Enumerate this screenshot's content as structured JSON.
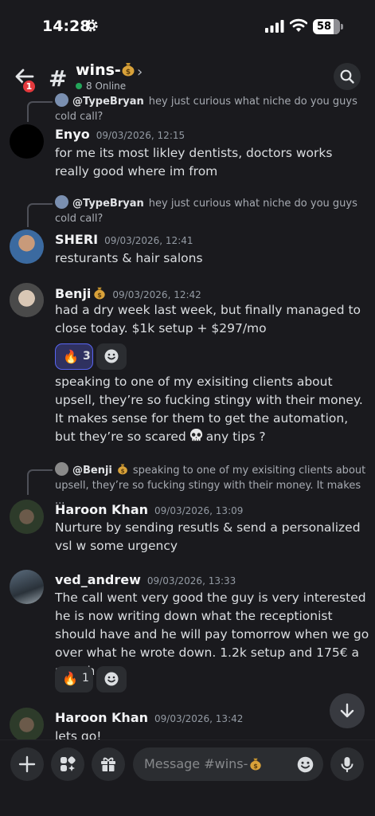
{
  "status_bar": {
    "time": "14:28",
    "battery": "58"
  },
  "header": {
    "back_badge": "1",
    "channel_name": "wins-",
    "online_text": "8 Online"
  },
  "messages": [
    {
      "reply_to": {
        "author": "@TypeBryan",
        "text": "hey just curious what niche do you guys cold call?"
      },
      "author": "Enyo",
      "timestamp": "09/03/2026, 12:15",
      "text": "for me its most likley dentists, doctors works really good where im from"
    },
    {
      "reply_to": {
        "author": "@TypeBryan",
        "text": "hey just curious what niche do you guys cold call?"
      },
      "author": "SHERI",
      "timestamp": "09/03/2026, 12:41",
      "text": "resturants & hair salons"
    },
    {
      "author": "Benji",
      "timestamp": "09/03/2026, 12:42",
      "text": "had a dry week last week, but finally managed to close today. $1k setup + $297/mo",
      "reaction": {
        "emoji": "🔥",
        "count": "3"
      },
      "text2": "speaking to one of my exisiting clients about upsell, they’re so fucking stingy with their money. It makes sense for them to get the automation, but they’re so scared",
      "text2_end": "any tips ?"
    },
    {
      "reply_to": {
        "author": "@Benji",
        "text": "speaking to one of my exisiting clients about upsell, they’re so fucking stingy with their money. It makes ..."
      },
      "author": "Haroon Khan",
      "timestamp": "09/03/2026, 13:09",
      "text": "Nurture by sending resutls & send a personalized vsl w some urgency"
    },
    {
      "author": "ved_andrew",
      "timestamp": "09/03/2026, 13:33",
      "text": "The call went very good the guy is very interested he is now writing down what the receptionist should have and he will pay tomorrow when we go over what he wrote down. 1.2k setup and 175€ a month",
      "reaction": {
        "emoji": "🔥",
        "count": "1"
      }
    },
    {
      "author": "Haroon Khan",
      "timestamp": "09/03/2026, 13:42",
      "text": "lets go!"
    }
  ],
  "composer": {
    "placeholder": "Message #wins-"
  },
  "colors": {
    "accent": "#5865f2",
    "online": "#23a55a",
    "badge": "#e5393d",
    "background": "#1a1a1e"
  }
}
